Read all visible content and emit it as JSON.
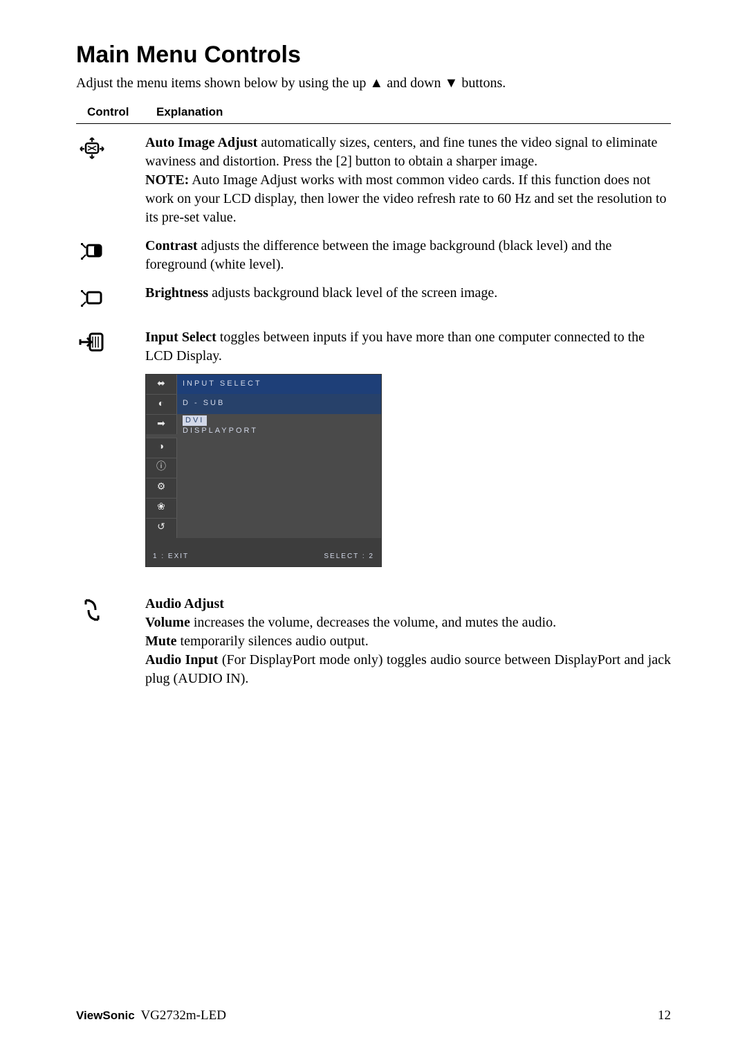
{
  "heading": "Main Menu Controls",
  "intro_pre": "Adjust the menu items shown below by using the up ",
  "intro_mid": " and down ",
  "intro_post": " buttons.",
  "intro_up": "▲",
  "intro_down": "▼",
  "table_head_control": "Control",
  "table_head_explanation": "Explanation",
  "entries": {
    "auto_image": {
      "lead": "Auto Image Adjust",
      "rest1": " automatically sizes, centers, and fine tunes the video signal to eliminate waviness and distortion. Press the [2] button to obtain a sharper image.",
      "note_label": "NOTE:",
      "note_text": " Auto Image Adjust works with most common video cards. If this function does not work on your LCD display, then lower the video refresh rate to 60 Hz and set the resolution to its pre-set value."
    },
    "contrast": {
      "lead": "Contrast",
      "rest": " adjusts the difference between the image background  (black level) and the foreground (white level)."
    },
    "brightness": {
      "lead": "Brightness",
      "rest": " adjusts background black level of the screen image."
    },
    "input_select": {
      "lead": "Input Select",
      "rest": " toggles between inputs if you have more than one computer connected to the LCD Display."
    },
    "audio": {
      "title": "Audio Adjust",
      "vol_lead": "Volume",
      "vol_rest": " increases the volume, decreases the volume, and mutes the audio.",
      "mute_lead": "Mute",
      "mute_rest": " temporarily silences audio output.",
      "ain_lead": "Audio  Input",
      "ain_rest": "  (For  DisplayPort  mode  only)  toggles  audio  source  between DisplayPort and jack plug (AUDIO IN)."
    }
  },
  "osd": {
    "title": "INPUT SELECT",
    "opt1": "D - SUB",
    "opt2_sel": "DVI",
    "opt3": "DISPLAYPORT",
    "footer_left": "1 : EXIT",
    "footer_right": "SELECT : 2"
  },
  "footer_brand": "ViewSonic",
  "footer_model": "VG2732m-LED",
  "footer_page": "12"
}
